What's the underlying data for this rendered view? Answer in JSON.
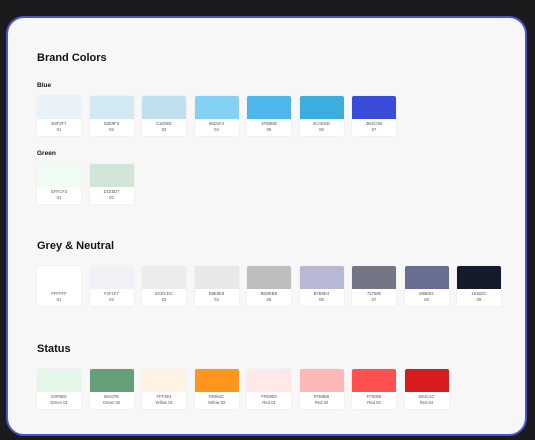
{
  "sections": {
    "brand": {
      "title": "Brand Colors",
      "groups": [
        {
          "title": "Blue",
          "swatches": [
            {
              "hex": "E8F2F7",
              "label": "01",
              "color": "#E8F2F7"
            },
            {
              "hex": "D2E9F3",
              "label": "02",
              "color": "#D2E9F3"
            },
            {
              "hex": "C1E0EE",
              "label": "03",
              "color": "#C1E0EE"
            },
            {
              "hex": "85D1F4",
              "label": "04",
              "color": "#85D1F4"
            },
            {
              "hex": "4FB6EB",
              "label": "05",
              "color": "#4FB6EB"
            },
            {
              "hex": "3CAEDD",
              "label": "06",
              "color": "#3CAEDD"
            },
            {
              "hex": "3B4CDB",
              "label": "07",
              "color": "#3B4CDB"
            }
          ]
        },
        {
          "title": "Green",
          "swatches": [
            {
              "hex": "EFFCF3",
              "label": "01",
              "color": "#EFFCF3"
            },
            {
              "hex": "D1E5D7",
              "label": "02",
              "color": "#D1E5D7"
            }
          ]
        }
      ]
    },
    "neutral": {
      "title": "Grey & Neutral",
      "swatches": [
        {
          "hex": "FFFFFF",
          "label": "01",
          "color": "#FFFFFF"
        },
        {
          "hex": "F1F1F7",
          "label": "02",
          "color": "#F1F1F7"
        },
        {
          "hex": "ECECEC",
          "label": "03",
          "color": "#ECECEC"
        },
        {
          "hex": "E8E8E8",
          "label": "04",
          "color": "#E8E8E8"
        },
        {
          "hex": "BEBEBE",
          "label": "05",
          "color": "#BEBEBE"
        },
        {
          "hex": "B7B8D4",
          "label": "06",
          "color": "#B7B8D4"
        },
        {
          "hex": "727685",
          "label": "07",
          "color": "#727685"
        },
        {
          "hex": "686E92",
          "label": "08",
          "color": "#686E92"
        },
        {
          "hex": "161B2C",
          "label": "09",
          "color": "#161B2C"
        }
      ]
    },
    "status": {
      "title": "Status",
      "swatches": [
        {
          "hex": "E3F6E8",
          "label": "Green 01",
          "color": "#E3F6E8"
        },
        {
          "hex": "66A07B",
          "label": "Green 02",
          "color": "#66A07B"
        },
        {
          "hex": "FFF3E4",
          "label": "Yellow 01",
          "color": "#FFF3E4"
        },
        {
          "hex": "FE961C",
          "label": "Yellow 02",
          "color": "#FE961C"
        },
        {
          "hex": "FFE8E8",
          "label": "Red 01",
          "color": "#FFE8E8"
        },
        {
          "hex": "FFB8B8",
          "label": "Red 02",
          "color": "#FFB8B8"
        },
        {
          "hex": "FF5050",
          "label": "Red 03",
          "color": "#FF5050"
        },
        {
          "hex": "D61C1C",
          "label": "Red 04",
          "color": "#D61C1C"
        }
      ]
    }
  },
  "colors": {
    "frame_border": "#4a52d6",
    "card_background": "#f7f7f8",
    "page_background": "#1b1b1d"
  }
}
